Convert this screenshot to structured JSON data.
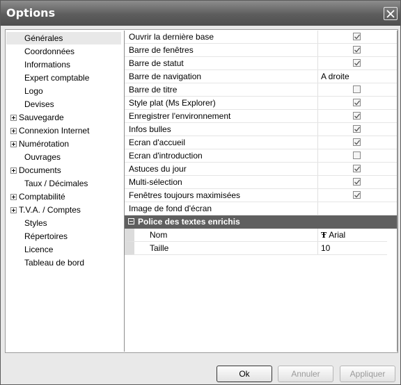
{
  "window": {
    "title": "Options"
  },
  "tree": [
    {
      "label": "Générales",
      "expandable": false,
      "selected": true
    },
    {
      "label": "Coordonnées",
      "expandable": false
    },
    {
      "label": "Informations",
      "expandable": false
    },
    {
      "label": "Expert comptable",
      "expandable": false
    },
    {
      "label": "Logo",
      "expandable": false
    },
    {
      "label": "Devises",
      "expandable": false
    },
    {
      "label": "Sauvegarde",
      "expandable": true
    },
    {
      "label": "Connexion Internet",
      "expandable": true
    },
    {
      "label": "Numérotation",
      "expandable": true
    },
    {
      "label": "Ouvrages",
      "expandable": false
    },
    {
      "label": "Documents",
      "expandable": true
    },
    {
      "label": "Taux / Décimales",
      "expandable": false
    },
    {
      "label": "Comptabilité",
      "expandable": true
    },
    {
      "label": "T.V.A. / Comptes",
      "expandable": true
    },
    {
      "label": "Styles",
      "expandable": false
    },
    {
      "label": "Répertoires",
      "expandable": false
    },
    {
      "label": "Licence",
      "expandable": false
    },
    {
      "label": "Tableau de bord",
      "expandable": false
    }
  ],
  "properties": [
    {
      "name": "Ouvrir la dernière base",
      "type": "checkbox",
      "checked": true
    },
    {
      "name": "Barre de fenêtres",
      "type": "checkbox",
      "checked": true
    },
    {
      "name": "Barre de statut",
      "type": "checkbox",
      "checked": true
    },
    {
      "name": "Barre de navigation",
      "type": "text",
      "value": "A droite"
    },
    {
      "name": "Barre de titre",
      "type": "checkbox",
      "checked": false
    },
    {
      "name": "Style plat (Ms Explorer)",
      "type": "checkbox",
      "checked": true
    },
    {
      "name": "Enregistrer l'environnement",
      "type": "checkbox",
      "checked": true
    },
    {
      "name": "Infos bulles",
      "type": "checkbox",
      "checked": true
    },
    {
      "name": "Ecran d'accueil",
      "type": "checkbox",
      "checked": true
    },
    {
      "name": "Ecran d'introduction",
      "type": "checkbox",
      "checked": false
    },
    {
      "name": "Astuces du jour",
      "type": "checkbox",
      "checked": true
    },
    {
      "name": "Multi-sélection",
      "type": "checkbox",
      "checked": true
    },
    {
      "name": "Fenêtres toujours maximisées",
      "type": "checkbox",
      "checked": true
    },
    {
      "name": "Image de fond d'écran",
      "type": "text",
      "value": ""
    }
  ],
  "section": {
    "label": "Police des textes enrichis",
    "rows": [
      {
        "name": "Nom",
        "value": "Arial",
        "icon": "font-icon"
      },
      {
        "name": "Taille",
        "value": "10"
      }
    ]
  },
  "buttons": {
    "ok": "Ok",
    "cancel": "Annuler",
    "apply": "Appliquer"
  }
}
